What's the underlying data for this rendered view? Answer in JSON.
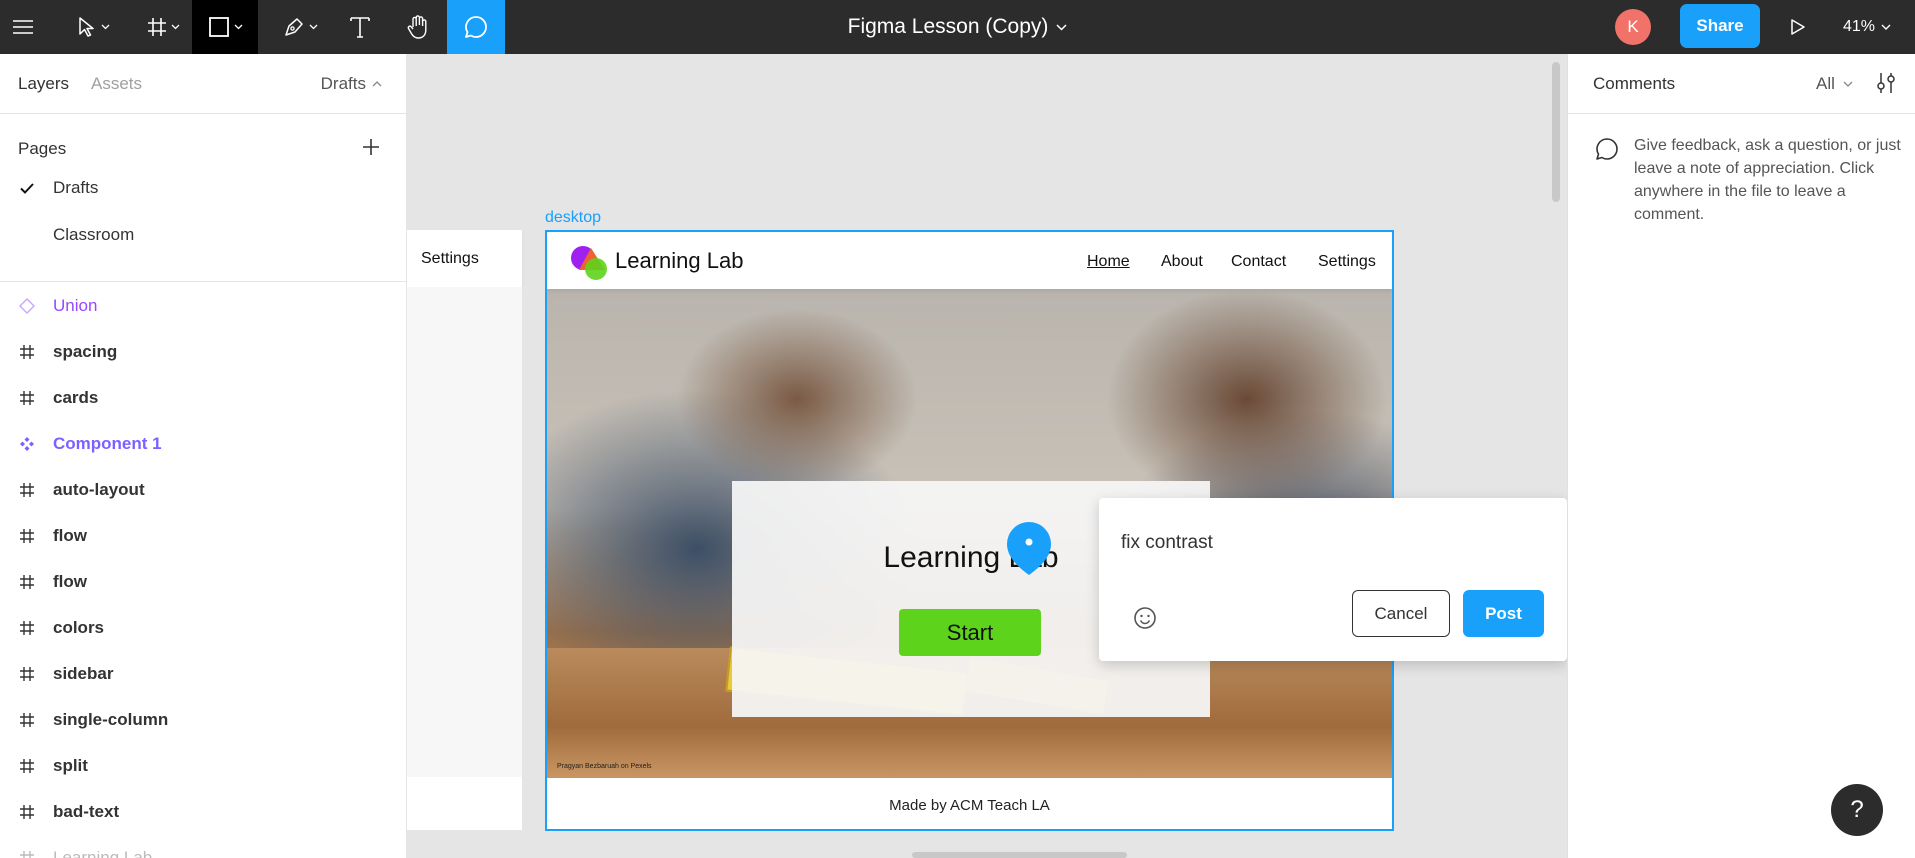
{
  "toolbar": {
    "document_title": "Figma Lesson (Copy)",
    "avatar_initial": "K",
    "share_label": "Share",
    "zoom_level": "41%",
    "accent_color": "#18a0fb",
    "active_tool": "comment-tool"
  },
  "left_panel": {
    "tabs": [
      "Layers",
      "Assets"
    ],
    "drafts_label": "Drafts",
    "pages_heading": "Pages",
    "pages": [
      {
        "label": "Drafts",
        "current": true
      },
      {
        "label": "Classroom",
        "current": false
      }
    ],
    "layers": [
      {
        "label": "Union",
        "icon": "union-icon"
      },
      {
        "label": "spacing",
        "icon": "frame-icon"
      },
      {
        "label": "cards",
        "icon": "frame-icon"
      },
      {
        "label": "Component 1",
        "icon": "component-icon"
      },
      {
        "label": "auto-layout",
        "icon": "frame-icon"
      },
      {
        "label": "flow",
        "icon": "frame-icon"
      },
      {
        "label": "flow",
        "icon": "frame-icon"
      },
      {
        "label": "colors",
        "icon": "frame-icon"
      },
      {
        "label": "sidebar",
        "icon": "frame-icon"
      },
      {
        "label": "single-column",
        "icon": "frame-icon"
      },
      {
        "label": "split",
        "icon": "frame-icon"
      },
      {
        "label": "bad-text",
        "icon": "frame-icon"
      },
      {
        "label": "Learning Lab",
        "icon": "frame-icon"
      }
    ]
  },
  "canvas": {
    "frame_label": "desktop",
    "ghost_nav_label": "Settings",
    "design": {
      "brand": "Learning Lab",
      "nav_links": [
        "Home",
        "About",
        "Contact",
        "Settings"
      ],
      "hero_title": "Learning Lab",
      "hero_button": "Start",
      "photo_credit": "Pragyan Bezbaruah on Pexels",
      "footer": "Made by ACM Teach LA",
      "button_color": "#5ed31c"
    },
    "comment": {
      "input_value": "fix contrast",
      "cancel_label": "Cancel",
      "post_label": "Post"
    },
    "help_label": "?"
  },
  "right_panel": {
    "title": "Comments",
    "filter": "All",
    "empty_message": "Give feedback, ask a question, or just leave a note of appreciation. Click anywhere in the file to leave a comment."
  }
}
